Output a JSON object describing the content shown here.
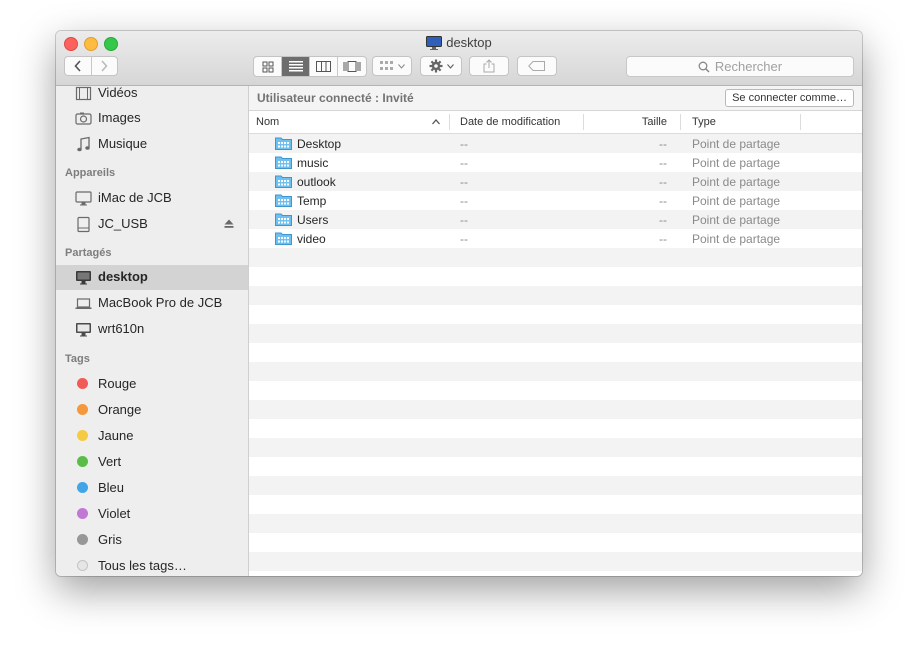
{
  "window": {
    "title": "desktop"
  },
  "toolbar": {
    "search_placeholder": "Rechercher"
  },
  "sidebar": {
    "favorites": [
      {
        "label": "Vidéos",
        "icon": "film-icon"
      },
      {
        "label": "Images",
        "icon": "camera-icon"
      },
      {
        "label": "Musique",
        "icon": "music-note-icon"
      }
    ],
    "devices_title": "Appareils",
    "devices": [
      {
        "label": "iMac de JCB",
        "icon": "imac-icon"
      },
      {
        "label": "JC_USB",
        "icon": "drive-icon"
      }
    ],
    "shared_title": "Partagés",
    "shared": [
      {
        "label": "desktop",
        "icon": "monitor-icon"
      },
      {
        "label": "MacBook Pro de JCB",
        "icon": "laptop-icon"
      },
      {
        "label": "wrt610n",
        "icon": "monitor-icon"
      }
    ],
    "tags_title": "Tags",
    "tags": [
      {
        "label": "Rouge",
        "color": "#f15a57"
      },
      {
        "label": "Orange",
        "color": "#f3983d"
      },
      {
        "label": "Jaune",
        "color": "#f4cb43"
      },
      {
        "label": "Vert",
        "color": "#5cbc48"
      },
      {
        "label": "Bleu",
        "color": "#43a5e8"
      },
      {
        "label": "Violet",
        "color": "#c178d4"
      },
      {
        "label": "Gris",
        "color": "#979797"
      },
      {
        "label": "Tous les tags…",
        "color": "#e6e6e6"
      }
    ]
  },
  "main": {
    "status": "Utilisateur connecté : Invité",
    "connect_button": "Se connecter comme…",
    "columns": {
      "name": "Nom",
      "date": "Date de modification",
      "size": "Taille",
      "type": "Type"
    },
    "rows": [
      {
        "name": "Desktop",
        "date": "--",
        "size": "--",
        "type": "Point de partage"
      },
      {
        "name": "music",
        "date": "--",
        "size": "--",
        "type": "Point de partage"
      },
      {
        "name": "outlook",
        "date": "--",
        "size": "--",
        "type": "Point de partage"
      },
      {
        "name": "Temp",
        "date": "--",
        "size": "--",
        "type": "Point de partage"
      },
      {
        "name": "Users",
        "date": "--",
        "size": "--",
        "type": "Point de partage"
      },
      {
        "name": "video",
        "date": "--",
        "size": "--",
        "type": "Point de partage"
      }
    ]
  }
}
